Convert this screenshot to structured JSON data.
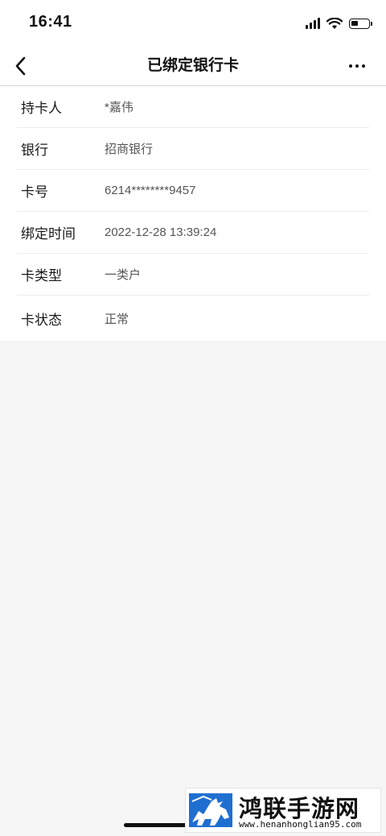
{
  "status_bar": {
    "time": "16:41"
  },
  "nav": {
    "title": "已绑定银行卡"
  },
  "details": [
    {
      "label": "持卡人",
      "value": "*嘉伟"
    },
    {
      "label": "银行",
      "value": "招商银行"
    },
    {
      "label": "卡号",
      "value": "6214********9457"
    },
    {
      "label": "绑定时间",
      "value": "2022-12-28 13:39:24"
    },
    {
      "label": "卡类型",
      "value": "一类户"
    },
    {
      "label": "卡状态",
      "value": "正常"
    }
  ],
  "watermark": {
    "title": "鸿联手游网",
    "url": "www.henanhonglian95.com"
  },
  "colors": {
    "background": "#f6f6f6",
    "card": "#ffffff",
    "text": "#111111",
    "value_text": "#555555",
    "logo_blue": "#1f6fd1"
  }
}
